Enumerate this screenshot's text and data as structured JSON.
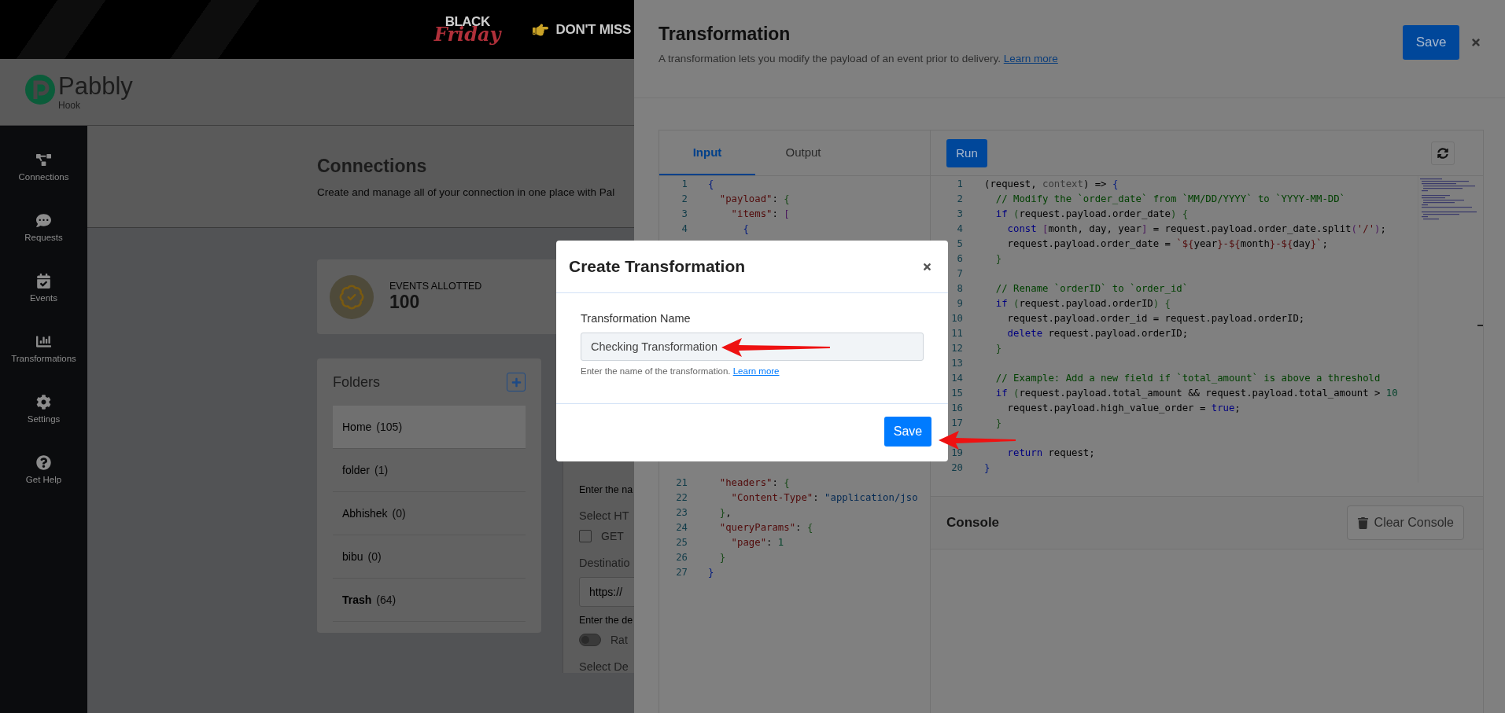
{
  "banner": {
    "badge_top": "BLACK",
    "badge_script": "Friday",
    "headline": "DON'T MISS"
  },
  "app_header": {
    "logo_text": "Pabbly",
    "logo_subtext": "Hook"
  },
  "sidebar": {
    "items": [
      {
        "label": "Connections",
        "kind": "connections"
      },
      {
        "label": "Requests",
        "kind": "requests"
      },
      {
        "label": "Events",
        "kind": "events"
      },
      {
        "label": "Transformations",
        "kind": "transformations"
      },
      {
        "label": "Settings",
        "kind": "settings"
      },
      {
        "label": "Get Help",
        "kind": "help"
      }
    ]
  },
  "page": {
    "title": "Connections",
    "subtitle": "Create and manage all of your connection in one place with Pal"
  },
  "events_card": {
    "label": "EVENTS ALLOTTED",
    "value": "100"
  },
  "folders": {
    "title": "Folders",
    "items": [
      {
        "name": "Home",
        "count": "(105)",
        "selected": true,
        "kind": "folder"
      },
      {
        "name": "folder",
        "count": "(1)",
        "selected": false,
        "kind": "folder"
      },
      {
        "name": "Abhishek",
        "count": "(0)",
        "selected": false,
        "kind": "folder"
      },
      {
        "name": "bibu",
        "count": "(0)",
        "selected": false,
        "kind": "folder"
      },
      {
        "name": "Trash",
        "count": "(64)",
        "selected": false,
        "kind": "trash"
      }
    ]
  },
  "form_fragment": {
    "items": [
      {
        "kind": "hint",
        "text": "Enter the na"
      },
      {
        "kind": "heading",
        "text": "Select HT"
      },
      {
        "kind": "checkbox",
        "label": "GET",
        "checked": false
      },
      {
        "kind": "heading",
        "text": "Destinatio"
      },
      {
        "kind": "input",
        "value": "https://"
      },
      {
        "kind": "hint",
        "text": "Enter the de"
      },
      {
        "kind": "toggle",
        "label": "Rat",
        "on": false
      },
      {
        "kind": "heading",
        "text": "Select De"
      }
    ]
  },
  "drawer": {
    "title": "Transformation",
    "subtitle": "A transformation lets you modify the payload of an event prior to delivery.",
    "subtitle_link": "Learn more",
    "save": "Save",
    "tabs": [
      {
        "label": "Input",
        "selected": true
      },
      {
        "label": "Output",
        "selected": false
      }
    ],
    "input_lines_top": [
      {
        "n": "1",
        "t": [
          {
            "kind": "b1",
            "text": "{"
          }
        ]
      },
      {
        "n": "2",
        "t": [
          {
            "kind": "s",
            "text": "  \"payload\""
          },
          {
            "kind": "p",
            "text": ": "
          },
          {
            "kind": "b2",
            "text": "{"
          }
        ]
      },
      {
        "n": "3",
        "t": [
          {
            "kind": "s",
            "text": "    \"items\""
          },
          {
            "kind": "p",
            "text": ": "
          },
          {
            "kind": "b3",
            "text": "["
          }
        ]
      },
      {
        "n": "4",
        "t": [
          {
            "kind": "b1",
            "text": "      {"
          }
        ]
      }
    ],
    "input_lines_bottom": [
      {
        "n": "21",
        "t": [
          {
            "kind": "s",
            "text": "  \"headers\""
          },
          {
            "kind": "p",
            "text": ": "
          },
          {
            "kind": "b2",
            "text": "{"
          }
        ]
      },
      {
        "n": "22",
        "t": [
          {
            "kind": "s",
            "text": "    \"Content-Type\""
          },
          {
            "kind": "p",
            "text": ": "
          },
          {
            "kind": "v",
            "text": "\"application/jso"
          }
        ]
      },
      {
        "n": "23",
        "t": [
          {
            "kind": "b2",
            "text": "  }"
          },
          {
            "kind": "p",
            "text": ","
          }
        ]
      },
      {
        "n": "24",
        "t": [
          {
            "kind": "s",
            "text": "  \"queryParams\""
          },
          {
            "kind": "p",
            "text": ": "
          },
          {
            "kind": "b2",
            "text": "{"
          }
        ]
      },
      {
        "n": "25",
        "t": [
          {
            "kind": "s",
            "text": "    \"page\""
          },
          {
            "kind": "p",
            "text": ": "
          },
          {
            "kind": "n",
            "text": "1"
          }
        ]
      },
      {
        "n": "26",
        "t": [
          {
            "kind": "b2",
            "text": "  }"
          }
        ]
      },
      {
        "n": "27",
        "t": [
          {
            "kind": "b1",
            "text": "}"
          }
        ]
      }
    ],
    "run": "Run",
    "code_lines": [
      {
        "n": "1",
        "t": [
          {
            "kind": "p",
            "text": "(request, "
          },
          {
            "kind": "m",
            "text": "context"
          },
          {
            "kind": "p",
            "text": ") => "
          },
          {
            "kind": "b1",
            "text": "{"
          }
        ]
      },
      {
        "n": "2",
        "t": [
          {
            "kind": "c",
            "text": "  // Modify the `order_date` from `MM/DD/YYYY` to `YYYY-MM-DD`"
          }
        ]
      },
      {
        "n": "3",
        "t": [
          {
            "kind": "k",
            "text": "  if "
          },
          {
            "kind": "b2",
            "text": "("
          },
          {
            "kind": "p",
            "text": "request.payload.order_date"
          },
          {
            "kind": "b2",
            "text": ")"
          },
          {
            "kind": "b2",
            "text": " {"
          }
        ]
      },
      {
        "n": "4",
        "t": [
          {
            "kind": "k",
            "text": "    const "
          },
          {
            "kind": "b3",
            "text": "["
          },
          {
            "kind": "p",
            "text": "month, day, year"
          },
          {
            "kind": "b3",
            "text": "]"
          },
          {
            "kind": "p",
            "text": " = request.payload.order_date.split"
          },
          {
            "kind": "b3",
            "text": "("
          },
          {
            "kind": "s",
            "text": "'/'"
          },
          {
            "kind": "b3",
            "text": ")"
          },
          {
            "kind": "p",
            "text": ";"
          }
        ]
      },
      {
        "n": "5",
        "t": [
          {
            "kind": "p",
            "text": "    request.payload.order_date = "
          },
          {
            "kind": "s",
            "text": "`${"
          },
          {
            "kind": "p",
            "text": "year"
          },
          {
            "kind": "s",
            "text": "}-${"
          },
          {
            "kind": "p",
            "text": "month"
          },
          {
            "kind": "s",
            "text": "}-${"
          },
          {
            "kind": "p",
            "text": "day"
          },
          {
            "kind": "s",
            "text": "}`"
          },
          {
            "kind": "p",
            "text": ";"
          }
        ]
      },
      {
        "n": "6",
        "t": [
          {
            "kind": "b2",
            "text": "  }"
          }
        ]
      },
      {
        "n": "7"
      },
      {
        "n": "8",
        "t": [
          {
            "kind": "c",
            "text": "  // Rename `orderID` to `order_id`"
          }
        ]
      },
      {
        "n": "9",
        "t": [
          {
            "kind": "k",
            "text": "  if "
          },
          {
            "kind": "b2",
            "text": "("
          },
          {
            "kind": "p",
            "text": "request.payload.orderID"
          },
          {
            "kind": "b2",
            "text": ")"
          },
          {
            "kind": "b2",
            "text": " {"
          }
        ]
      },
      {
        "n": "10",
        "t": [
          {
            "kind": "p",
            "text": "    request.payload.order_id = request.payload.orderID;"
          }
        ]
      },
      {
        "n": "11",
        "t": [
          {
            "kind": "k",
            "text": "    delete "
          },
          {
            "kind": "p",
            "text": "request.payload.orderID;"
          }
        ]
      },
      {
        "n": "12",
        "t": [
          {
            "kind": "b2",
            "text": "  }"
          }
        ]
      },
      {
        "n": "13"
      },
      {
        "n": "14",
        "t": [
          {
            "kind": "c",
            "text": "  // Example: Add a new field if `total_amount` is above a threshold"
          }
        ]
      },
      {
        "n": "15",
        "t": [
          {
            "kind": "k",
            "text": "  if "
          },
          {
            "kind": "b2",
            "text": "("
          },
          {
            "kind": "p",
            "text": "request.payload.total_amount && request.payload.total_amount > "
          },
          {
            "kind": "n",
            "text": "10"
          }
        ]
      },
      {
        "n": "16",
        "t": [
          {
            "kind": "p",
            "text": "    request.payload.high_value_order = "
          },
          {
            "kind": "k",
            "text": "true"
          },
          {
            "kind": "p",
            "text": ";"
          }
        ]
      },
      {
        "n": "17",
        "t": [
          {
            "kind": "b2",
            "text": "  }"
          }
        ]
      }
    ],
    "code_lines_after_arrow": [
      {
        "n": "19",
        "t": [
          {
            "kind": "k",
            "text": "    return "
          },
          {
            "kind": "p",
            "text": "request;"
          }
        ]
      },
      {
        "n": "20",
        "t": [
          {
            "kind": "b1",
            "text": "}"
          }
        ]
      }
    ],
    "console_title": "Console",
    "clear_console": "Clear Console"
  },
  "modal": {
    "title": "Create Transformation",
    "field_label": "Transformation Name",
    "field_value": "Checking Transformation",
    "hint": "Enter the name of the transformation.",
    "hint_link": "Learn more",
    "save": "Save"
  }
}
